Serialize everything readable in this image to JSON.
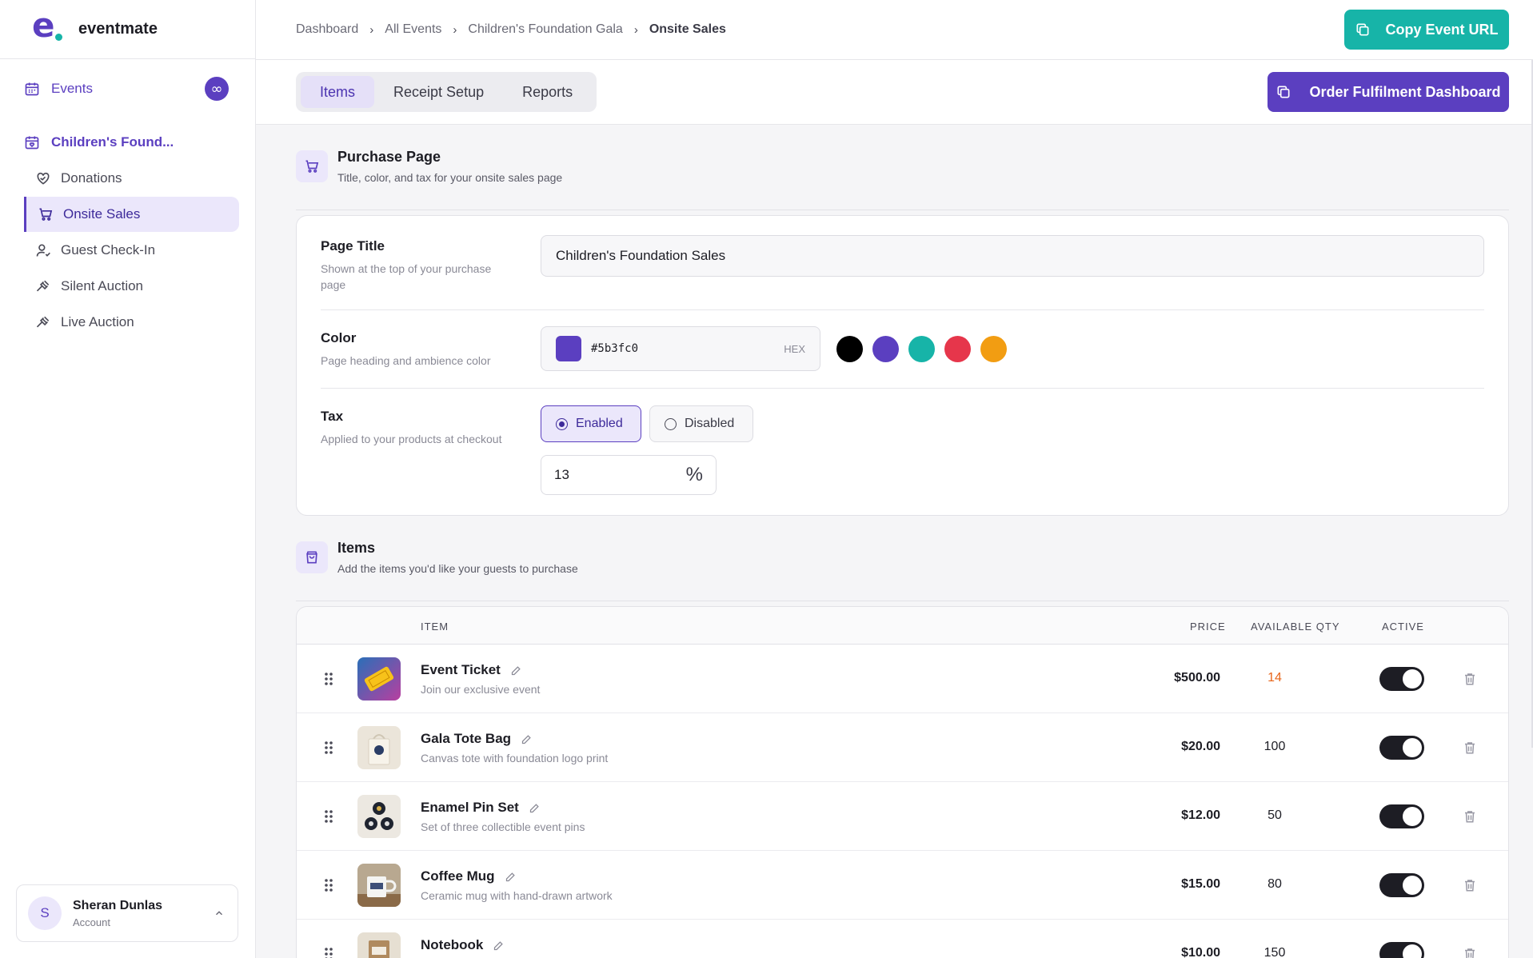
{
  "brand": {
    "name": "eventmate",
    "primary_color": "#5b3fc0",
    "accent_color": "#17b4a8"
  },
  "sidebar": {
    "events_label": "Events",
    "events_badge": "∞",
    "event_name": "Children's Found...",
    "items": [
      {
        "label": "Donations",
        "icon": "heart-handshake-icon",
        "active": false
      },
      {
        "label": "Onsite Sales",
        "icon": "cart-icon",
        "active": true
      },
      {
        "label": "Guest Check-In",
        "icon": "user-check-icon",
        "active": false
      },
      {
        "label": "Silent Auction",
        "icon": "gavel-icon",
        "active": false
      },
      {
        "label": "Live Auction",
        "icon": "gavel-icon",
        "active": false
      }
    ],
    "account": {
      "initial": "S",
      "name": "Sheran Dunlas",
      "subtitle": "Account"
    }
  },
  "header": {
    "breadcrumb": [
      "Dashboard",
      "All Events",
      "Children's Foundation Gala",
      "Onsite Sales"
    ],
    "copy_url_label": "Copy Event URL"
  },
  "tabs": [
    {
      "label": "Items",
      "active": true
    },
    {
      "label": "Receipt Setup",
      "active": false
    },
    {
      "label": "Reports",
      "active": false
    }
  ],
  "fulfilment_button_label": "Order Fulfilment Dashboard",
  "purchase_page": {
    "title": "Purchase Page",
    "subtitle": "Title, color, and tax for your onsite sales page",
    "page_title": {
      "label": "Page Title",
      "help": "Shown at the top of your purchase page",
      "value": "Children's Foundation Sales"
    },
    "color": {
      "label": "Color",
      "help": "Page heading and ambience color",
      "value": "#5b3fc0",
      "suffix": "HEX",
      "swatches": [
        "#000000",
        "#5b3fc0",
        "#17b4a8",
        "#e6364b",
        "#f29d12"
      ]
    },
    "tax": {
      "label": "Tax",
      "help": "Applied to your products at checkout",
      "enabled_label": "Enabled",
      "disabled_label": "Disabled",
      "enabled": true,
      "rate": "13",
      "unit": "%"
    }
  },
  "items_section": {
    "title": "Items",
    "subtitle": "Add the items you'd like your guests to purchase",
    "columns": {
      "item": "ITEM",
      "price": "PRICE",
      "qty": "AVAILABLE QTY",
      "active": "ACTIVE"
    },
    "rows": [
      {
        "name": "Event Ticket",
        "description": "Join our exclusive event",
        "price": "$500.00",
        "qty": "14",
        "low_stock": true,
        "active": true
      },
      {
        "name": "Gala Tote Bag",
        "description": "Canvas tote with foundation logo print",
        "price": "$20.00",
        "qty": "100",
        "low_stock": false,
        "active": true
      },
      {
        "name": "Enamel Pin Set",
        "description": "Set of three collectible event pins",
        "price": "$12.00",
        "qty": "50",
        "low_stock": false,
        "active": true
      },
      {
        "name": "Coffee Mug",
        "description": "Ceramic mug with hand-drawn artwork",
        "price": "$15.00",
        "qty": "80",
        "low_stock": false,
        "active": true
      },
      {
        "name": "Notebook",
        "description": "",
        "price": "$10.00",
        "qty": "150",
        "low_stock": false,
        "active": true
      }
    ]
  }
}
